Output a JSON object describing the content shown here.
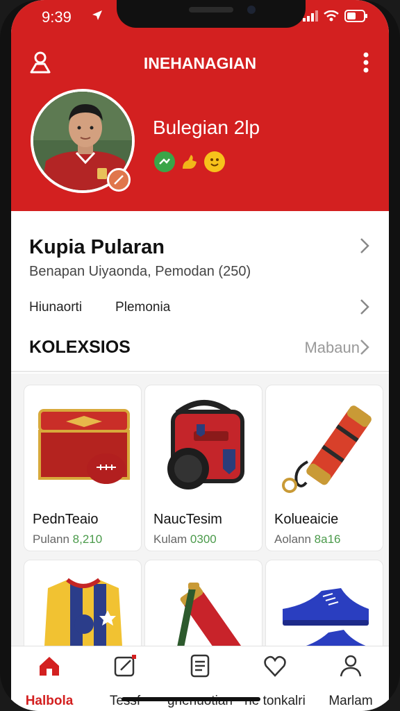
{
  "status": {
    "time": "9:39"
  },
  "header": {
    "title": "INEHANAGIAN",
    "profile_name": "Bulegian 2lp",
    "colors": {
      "primary": "#d32020"
    }
  },
  "info": {
    "title": "Kupia Pularan",
    "subtitle": "Benapan Uiyaonda, Pemodan (250)",
    "row_left": "Hiunaorti",
    "row_right": "Plemonia"
  },
  "collections": {
    "title": "KOLEXSIOS",
    "more": "Mabaun"
  },
  "products": [
    {
      "name": "PednTeaio",
      "price_label": "Pulann",
      "price": "8,210"
    },
    {
      "name": "NaucTesim",
      "price_label": "Kulam",
      "price": "0300"
    },
    {
      "name": "Kolueaicie",
      "price_label": "Aolann",
      "price": "8a16"
    }
  ],
  "tabs": [
    {
      "label": "Halbola",
      "icon": "home-icon"
    },
    {
      "label": "Tessf",
      "icon": "edit-icon"
    },
    {
      "label": "gnenuotian",
      "icon": "document-icon"
    },
    {
      "label": "ne tonkalri",
      "icon": "heart-icon"
    },
    {
      "label": "Marlam",
      "icon": "user-icon"
    }
  ]
}
